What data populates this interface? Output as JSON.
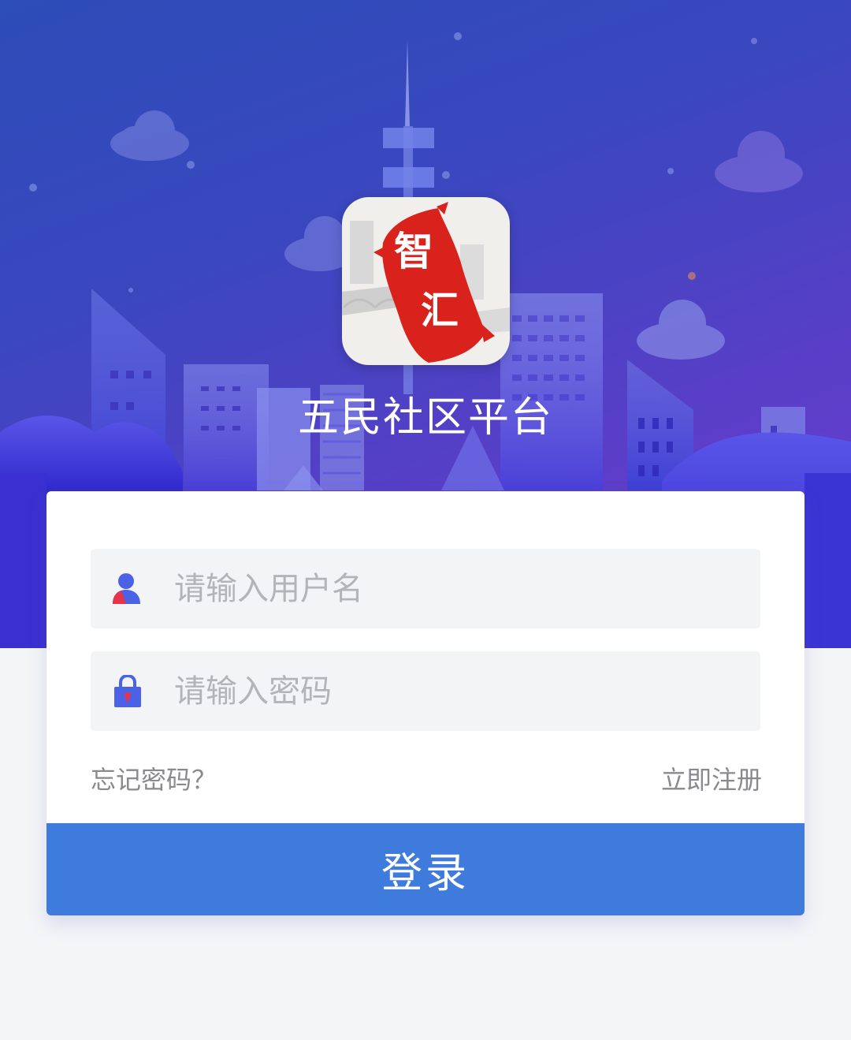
{
  "app": {
    "title": "五民社区平台",
    "logo_chars": [
      "智",
      "汇"
    ]
  },
  "form": {
    "username": {
      "icon": "user-icon",
      "placeholder": "请输入用户名",
      "value": ""
    },
    "password": {
      "icon": "lock-icon",
      "placeholder": "请输入密码",
      "value": ""
    },
    "forgot_label": "忘记密码？",
    "register_label": "立即注册",
    "login_label": "登录"
  },
  "colors": {
    "brand_blue": "#3e7bdd",
    "hero_start": "#2d4db8",
    "hero_end": "#6a3fd0",
    "logo_red": "#d9221c",
    "page_bg": "#f4f5f7"
  }
}
